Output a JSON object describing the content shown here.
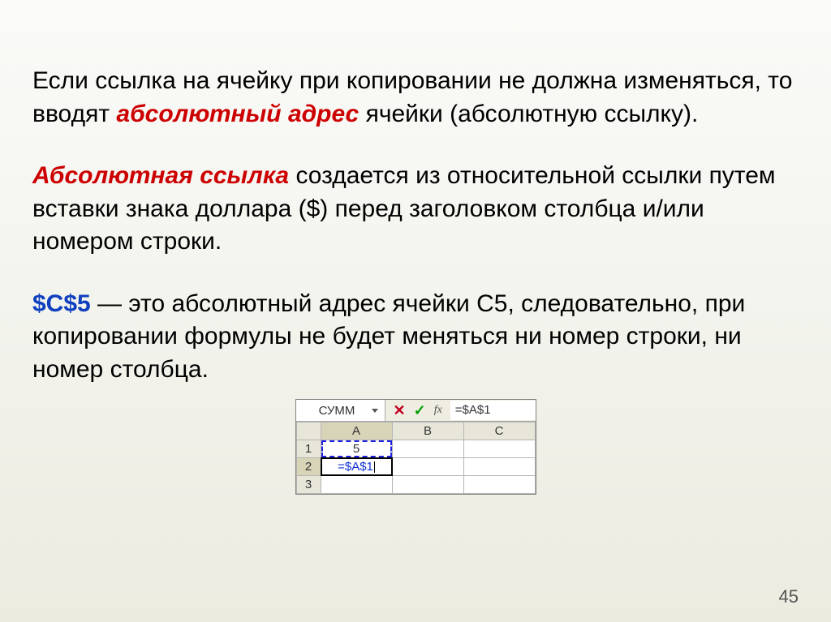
{
  "para1": {
    "t1": "Если ссылка на ячейку при копировании не должна изменяться, то вводят ",
    "em": "абсолютный адрес",
    "t2": " ячейки (абсолютную ссылку)."
  },
  "para2": {
    "em": "Абсолютная ссылка",
    "t1": " создается из относительной ссылки путем вставки знака доллара ($) перед заголовком столбца и/или номером строки."
  },
  "para3": {
    "em": "$C$5",
    "t1": " — это абсолютный адрес ячейки С5, следовательно, при копировании формулы не будет меняться ни номер строки, ни номер столбца."
  },
  "excel": {
    "namebox": "СУММ",
    "formula": "=$A$1",
    "columns": [
      "A",
      "B",
      "C"
    ],
    "rows": [
      "1",
      "2",
      "3"
    ],
    "a1": "5",
    "a2": "=$A$1"
  },
  "page_number": "45"
}
